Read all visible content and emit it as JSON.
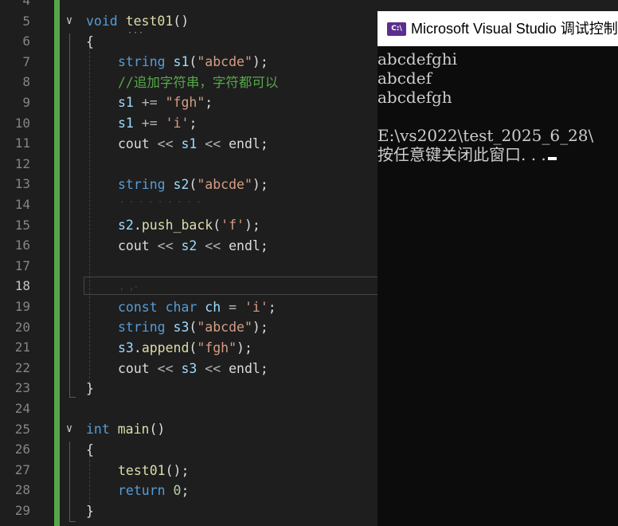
{
  "editor": {
    "lines": [
      {
        "n": "4"
      },
      {
        "n": "5"
      },
      {
        "n": "6"
      },
      {
        "n": "7"
      },
      {
        "n": "8"
      },
      {
        "n": "9"
      },
      {
        "n": "10"
      },
      {
        "n": "11"
      },
      {
        "n": "12"
      },
      {
        "n": "13"
      },
      {
        "n": "14"
      },
      {
        "n": "15"
      },
      {
        "n": "16"
      },
      {
        "n": "17"
      },
      {
        "n": "18"
      },
      {
        "n": "19"
      },
      {
        "n": "20"
      },
      {
        "n": "21"
      },
      {
        "n": "22"
      },
      {
        "n": "23"
      },
      {
        "n": "24"
      },
      {
        "n": "25"
      },
      {
        "n": "26"
      },
      {
        "n": "27"
      },
      {
        "n": "28"
      },
      {
        "n": "29"
      }
    ],
    "code": {
      "l5_kw": "void",
      "l5_fn": "test01",
      "l5_p": "()",
      "l6": "{",
      "l7_ty": "string",
      "l7_var": "s1",
      "l7_p1": "(",
      "l7_str": "\"abcde\"",
      "l7_p2": ");",
      "l8_cmt": "//追加字符串，字符都可以",
      "l9_var": "s1",
      "l9_op": " += ",
      "l9_str": "\"fgh\"",
      "l9_p": ";",
      "l10_var": "s1",
      "l10_op": " += ",
      "l10_str": "'i'",
      "l10_p": ";",
      "l11_a": "cout",
      "l11_op1": " << ",
      "l11_var": "s1",
      "l11_op2": " << ",
      "l11_b": "endl",
      "l11_p": ";",
      "l13_ty": "string",
      "l13_var": "s2",
      "l13_p1": "(",
      "l13_str": "\"abcde\"",
      "l13_p2": ");",
      "l15_var": "s2",
      "l15_fn": "push_back",
      "l15_p1": "(",
      "l15_str": "'f'",
      "l15_p2": ");",
      "l16_a": "cout",
      "l16_op1": " << ",
      "l16_var": "s2",
      "l16_op2": " << ",
      "l16_b": "endl",
      "l16_p": ";",
      "l19_kw1": "const",
      "l19_kw2": "char",
      "l19_var": "ch",
      "l19_op": " = ",
      "l19_str": "'i'",
      "l19_p": ";",
      "l20_ty": "string",
      "l20_var": "s3",
      "l20_p1": "(",
      "l20_str": "\"abcde\"",
      "l20_p2": ");",
      "l21_var": "s3",
      "l21_fn": "append",
      "l21_p1": "(",
      "l21_str": "\"fgh\"",
      "l21_p2": ");",
      "l22_a": "cout",
      "l22_op1": " << ",
      "l22_var": "s3",
      "l22_op2": " << ",
      "l22_b": "endl",
      "l22_p": ";",
      "l23": "}",
      "l25_kw": "int",
      "l25_fn": "main",
      "l25_p": "()",
      "l26": "{",
      "l27_fn": "test01",
      "l27_p": "();",
      "l28_kw": "return",
      "l28_num": "0",
      "l28_p": ";",
      "l29": "}"
    },
    "icons": {
      "fold": "chevron-down-icon"
    },
    "colors": {
      "keyword": "#569cd6",
      "function": "#dcdcaa",
      "variable": "#9cdcfe",
      "string": "#d69d85",
      "comment": "#57a64a",
      "gutter_change": "#57a64a"
    }
  },
  "console": {
    "title": "Microsoft Visual Studio 调试控制台",
    "icon_label": "C:\\",
    "output": [
      "abcdefghi",
      "abcdef",
      "abcdefgh",
      "",
      "E:\\vs2022\\test_2025_6_28\\",
      "按任意键关闭此窗口. . ."
    ]
  }
}
